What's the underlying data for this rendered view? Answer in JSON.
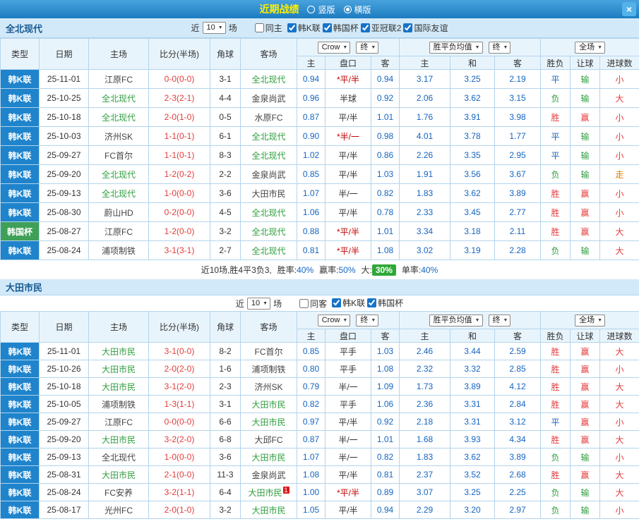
{
  "topbar": {
    "title": "近期战绩",
    "vertical_label": "竖版",
    "horizontal_label": "横版",
    "close_label": "×"
  },
  "table_header": {
    "type": "类型",
    "date": "日期",
    "home": "主场",
    "score": "比分(半场)",
    "corner": "角球",
    "away": "客场",
    "asia_home": "主",
    "asia_hc": "盘口",
    "asia_away": "客",
    "eu_home": "主",
    "eu_draw": "和",
    "eu_away": "客",
    "wl": "胜负",
    "hc_result": "让球",
    "goals": "进球数",
    "crow_select": "Crow",
    "final_select1": "终",
    "avg_select": "胜平负均值",
    "final_select2": "终",
    "scope_select": "全场"
  },
  "colors": {
    "accent_blue": "#1f84cc",
    "league_green": "#3fa058",
    "win_red": "#e43b3b",
    "loss_green": "#2e9e3e",
    "draw_blue": "#1565c0",
    "badge_green": "#2fa838"
  },
  "sections": [
    {
      "team": "全北现代",
      "filter": {
        "near": "近",
        "count": "10",
        "games": "场",
        "same_side": "同主",
        "leagues": [
          {
            "label": "韩K联",
            "checked": true
          },
          {
            "label": "韩国杯",
            "checked": true
          },
          {
            "label": "亚冠联2",
            "checked": true
          },
          {
            "label": "国际友谊",
            "checked": true
          }
        ]
      },
      "rows": [
        {
          "league": "韩K联",
          "league_color": "blue",
          "date": "25-11-01",
          "home": "江原FC",
          "home_focal": false,
          "score": "0-0(0-0)",
          "corner": "3-1",
          "away": "全北现代",
          "away_focal": true,
          "asia_home": "0.94",
          "handicap": "*平/半",
          "asia_away": "0.94",
          "eu_home": "3.17",
          "eu_draw": "3.25",
          "eu_away": "2.19",
          "res_wl": "平",
          "res_hc": "输",
          "res_goal": "小"
        },
        {
          "league": "韩K联",
          "league_color": "blue",
          "date": "25-10-25",
          "home": "全北现代",
          "home_focal": true,
          "score": "2-3(2-1)",
          "corner": "4-4",
          "away": "金泉尚武",
          "away_focal": false,
          "asia_home": "0.96",
          "handicap": "半球",
          "asia_away": "0.92",
          "eu_home": "2.06",
          "eu_draw": "3.62",
          "eu_away": "3.15",
          "res_wl": "负",
          "res_hc": "输",
          "res_goal": "大"
        },
        {
          "league": "韩K联",
          "league_color": "blue",
          "date": "25-10-18",
          "home": "全北现代",
          "home_focal": true,
          "score": "2-0(1-0)",
          "corner": "0-5",
          "away": "水原FC",
          "away_focal": false,
          "asia_home": "0.87",
          "handicap": "平/半",
          "asia_away": "1.01",
          "eu_home": "1.76",
          "eu_draw": "3.91",
          "eu_away": "3.98",
          "res_wl": "胜",
          "res_hc": "赢",
          "res_goal": "小"
        },
        {
          "league": "韩K联",
          "league_color": "blue",
          "date": "25-10-03",
          "home": "济州SK",
          "home_focal": false,
          "score": "1-1(0-1)",
          "corner": "6-1",
          "away": "全北现代",
          "away_focal": true,
          "asia_home": "0.90",
          "handicap": "*半/一",
          "asia_away": "0.98",
          "eu_home": "4.01",
          "eu_draw": "3.78",
          "eu_away": "1.77",
          "res_wl": "平",
          "res_hc": "输",
          "res_goal": "小"
        },
        {
          "league": "韩K联",
          "league_color": "blue",
          "date": "25-09-27",
          "home": "FC首尔",
          "home_focal": false,
          "score": "1-1(0-1)",
          "corner": "8-3",
          "away": "全北现代",
          "away_focal": true,
          "asia_home": "1.02",
          "handicap": "平/半",
          "asia_away": "0.86",
          "eu_home": "2.26",
          "eu_draw": "3.35",
          "eu_away": "2.95",
          "res_wl": "平",
          "res_hc": "输",
          "res_goal": "小"
        },
        {
          "league": "韩K联",
          "league_color": "blue",
          "date": "25-09-20",
          "home": "全北现代",
          "home_focal": true,
          "score": "1-2(0-2)",
          "corner": "2-2",
          "away": "金泉尚武",
          "away_focal": false,
          "asia_home": "0.85",
          "handicap": "平/半",
          "asia_away": "1.03",
          "eu_home": "1.91",
          "eu_draw": "3.56",
          "eu_away": "3.67",
          "res_wl": "负",
          "res_hc": "输",
          "res_goal": "走"
        },
        {
          "league": "韩K联",
          "league_color": "blue",
          "date": "25-09-13",
          "home": "全北现代",
          "home_focal": true,
          "score": "1-0(0-0)",
          "corner": "3-6",
          "away": "大田市民",
          "away_focal": false,
          "asia_home": "1.07",
          "handicap": "半/一",
          "asia_away": "0.82",
          "eu_home": "1.83",
          "eu_draw": "3.62",
          "eu_away": "3.89",
          "res_wl": "胜",
          "res_hc": "赢",
          "res_goal": "小"
        },
        {
          "league": "韩K联",
          "league_color": "blue",
          "date": "25-08-30",
          "home": "蔚山HD",
          "home_focal": false,
          "score": "0-2(0-0)",
          "corner": "4-5",
          "away": "全北现代",
          "away_focal": true,
          "asia_home": "1.06",
          "handicap": "平/半",
          "asia_away": "0.78",
          "eu_home": "2.33",
          "eu_draw": "3.45",
          "eu_away": "2.77",
          "res_wl": "胜",
          "res_hc": "赢",
          "res_goal": "小"
        },
        {
          "league": "韩国杯",
          "league_color": "green",
          "date": "25-08-27",
          "home": "江原FC",
          "home_focal": false,
          "score": "1-2(0-0)",
          "corner": "3-2",
          "away": "全北现代",
          "away_focal": true,
          "asia_home": "0.88",
          "handicap": "*平/半",
          "asia_away": "1.01",
          "eu_home": "3.34",
          "eu_draw": "3.18",
          "eu_away": "2.11",
          "res_wl": "胜",
          "res_hc": "赢",
          "res_goal": "大"
        },
        {
          "league": "韩K联",
          "league_color": "blue",
          "date": "25-08-24",
          "home": "浦项制铁",
          "home_focal": false,
          "score": "3-1(3-1)",
          "corner": "2-7",
          "away": "全北现代",
          "away_focal": true,
          "asia_home": "0.81",
          "handicap": "*平/半",
          "asia_away": "1.08",
          "eu_home": "3.02",
          "eu_draw": "3.19",
          "eu_away": "2.28",
          "res_wl": "负",
          "res_hc": "输",
          "res_goal": "大"
        }
      ],
      "summary": {
        "prefix": "近10场,胜4平3负3,",
        "win_label": "胜率:",
        "win": "40%",
        "profit_label": "赢率:",
        "profit": "50%",
        "big_label": "大:",
        "big": "30%",
        "single_label": "单率:",
        "single": "40%"
      }
    },
    {
      "team": "大田市民",
      "filter": {
        "near": "近",
        "count": "10",
        "games": "场",
        "same_side": "同客",
        "leagues": [
          {
            "label": "韩K联",
            "checked": true
          },
          {
            "label": "韩国杯",
            "checked": true
          }
        ]
      },
      "rows": [
        {
          "league": "韩K联",
          "league_color": "blue",
          "date": "25-11-01",
          "home": "大田市民",
          "home_focal": true,
          "score": "3-1(0-0)",
          "corner": "8-2",
          "away": "FC首尔",
          "away_focal": false,
          "asia_home": "0.85",
          "handicap": "平手",
          "asia_away": "1.03",
          "eu_home": "2.46",
          "eu_draw": "3.44",
          "eu_away": "2.59",
          "res_wl": "胜",
          "res_hc": "赢",
          "res_goal": "大"
        },
        {
          "league": "韩K联",
          "league_color": "blue",
          "date": "25-10-26",
          "home": "大田市民",
          "home_focal": true,
          "score": "2-0(2-0)",
          "corner": "1-6",
          "away": "浦项制铁",
          "away_focal": false,
          "asia_home": "0.80",
          "handicap": "平手",
          "asia_away": "1.08",
          "eu_home": "2.32",
          "eu_draw": "3.32",
          "eu_away": "2.85",
          "res_wl": "胜",
          "res_hc": "赢",
          "res_goal": "小"
        },
        {
          "league": "韩K联",
          "league_color": "blue",
          "date": "25-10-18",
          "home": "大田市民",
          "home_focal": true,
          "score": "3-1(2-0)",
          "corner": "2-3",
          "away": "济州SK",
          "away_focal": false,
          "asia_home": "0.79",
          "handicap": "半/一",
          "asia_away": "1.09",
          "eu_home": "1.73",
          "eu_draw": "3.89",
          "eu_away": "4.12",
          "res_wl": "胜",
          "res_hc": "赢",
          "res_goal": "大"
        },
        {
          "league": "韩K联",
          "league_color": "blue",
          "date": "25-10-05",
          "home": "浦项制铁",
          "home_focal": false,
          "score": "1-3(1-1)",
          "corner": "3-1",
          "away": "大田市民",
          "away_focal": true,
          "asia_home": "0.82",
          "handicap": "平手",
          "asia_away": "1.06",
          "eu_home": "2.36",
          "eu_draw": "3.31",
          "eu_away": "2.84",
          "res_wl": "胜",
          "res_hc": "赢",
          "res_goal": "大"
        },
        {
          "league": "韩K联",
          "league_color": "blue",
          "date": "25-09-27",
          "home": "江原FC",
          "home_focal": false,
          "score": "0-0(0-0)",
          "corner": "6-6",
          "away": "大田市民",
          "away_focal": true,
          "asia_home": "0.97",
          "handicap": "平/半",
          "asia_away": "0.92",
          "eu_home": "2.18",
          "eu_draw": "3.31",
          "eu_away": "3.12",
          "res_wl": "平",
          "res_hc": "赢",
          "res_goal": "小"
        },
        {
          "league": "韩K联",
          "league_color": "blue",
          "date": "25-09-20",
          "home": "大田市民",
          "home_focal": true,
          "score": "3-2(2-0)",
          "corner": "6-8",
          "away": "大邱FC",
          "away_focal": false,
          "asia_home": "0.87",
          "handicap": "半/一",
          "asia_away": "1.01",
          "eu_home": "1.68",
          "eu_draw": "3.93",
          "eu_away": "4.34",
          "res_wl": "胜",
          "res_hc": "赢",
          "res_goal": "大"
        },
        {
          "league": "韩K联",
          "league_color": "blue",
          "date": "25-09-13",
          "home": "全北现代",
          "home_focal": false,
          "score": "1-0(0-0)",
          "corner": "3-6",
          "away": "大田市民",
          "away_focal": true,
          "asia_home": "1.07",
          "handicap": "半/一",
          "asia_away": "0.82",
          "eu_home": "1.83",
          "eu_draw": "3.62",
          "eu_away": "3.89",
          "res_wl": "负",
          "res_hc": "输",
          "res_goal": "小"
        },
        {
          "league": "韩K联",
          "league_color": "blue",
          "date": "25-08-31",
          "home": "大田市民",
          "home_focal": true,
          "score": "2-1(0-0)",
          "corner": "11-3",
          "away": "金泉尚武",
          "away_focal": false,
          "asia_home": "1.08",
          "handicap": "平/半",
          "asia_away": "0.81",
          "eu_home": "2.37",
          "eu_draw": "3.52",
          "eu_away": "2.68",
          "res_wl": "胜",
          "res_hc": "赢",
          "res_goal": "大"
        },
        {
          "league": "韩K联",
          "league_color": "blue",
          "date": "25-08-24",
          "home": "FC安养",
          "home_focal": false,
          "score": "3-2(1-1)",
          "corner": "6-4",
          "away": "大田市民",
          "away_focal": true,
          "away_badge": "1",
          "asia_home": "1.00",
          "handicap": "*平/半",
          "asia_away": "0.89",
          "eu_home": "3.07",
          "eu_draw": "3.25",
          "eu_away": "2.25",
          "res_wl": "负",
          "res_hc": "输",
          "res_goal": "大"
        },
        {
          "league": "韩K联",
          "league_color": "blue",
          "date": "25-08-17",
          "home": "光州FC",
          "home_focal": false,
          "score": "2-0(1-0)",
          "corner": "3-2",
          "away": "大田市民",
          "away_focal": true,
          "asia_home": "1.05",
          "handicap": "平/半",
          "asia_away": "0.94",
          "eu_home": "2.29",
          "eu_draw": "3.20",
          "eu_away": "2.97",
          "res_wl": "负",
          "res_hc": "输",
          "res_goal": "小"
        }
      ]
    }
  ]
}
